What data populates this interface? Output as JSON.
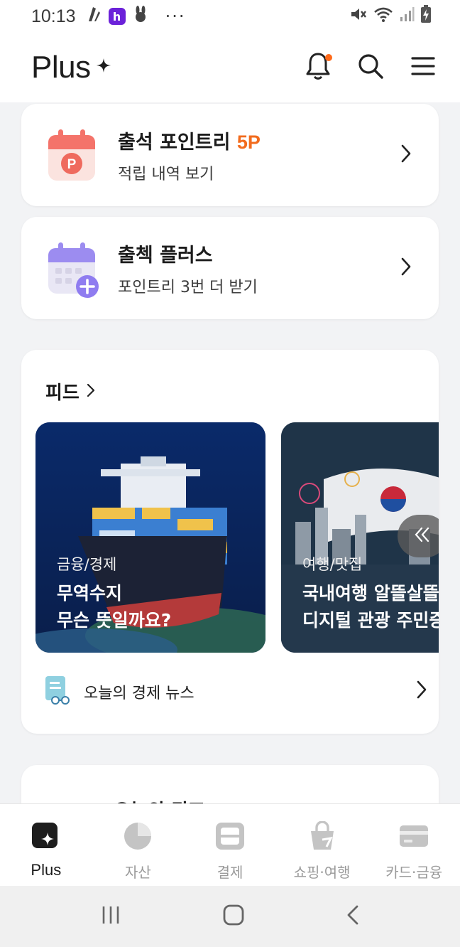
{
  "status": {
    "time": "10:13",
    "icons": [
      "gesture-icon",
      "h-app-icon",
      "bunny-icon",
      "more-notif-icon"
    ],
    "right_icons": [
      "mute-icon",
      "wifi-icon",
      "signal-icon",
      "battery-charging-icon"
    ],
    "more": "···"
  },
  "header": {
    "brand": "Plus",
    "icons": [
      "bell-icon",
      "search-icon",
      "menu-icon"
    ],
    "colors": {
      "notification_dot": "#ff6a1a"
    }
  },
  "attendance": {
    "title": "출석 포인트리 ",
    "points": "5P",
    "subtitle": "적립 내역 보기",
    "icon": "calendar-p-icon"
  },
  "check_plus": {
    "title": "출첵 플러스",
    "subtitle": "포인트리 3번 더 받기",
    "icon": "calendar-plus-icon"
  },
  "feed": {
    "title": "피드",
    "tiles": [
      {
        "category": "금융/경제",
        "headline": "무역수지\n무슨 뜻일까요?",
        "image": "cargo-ship-illustration"
      },
      {
        "category": "여행/맛집",
        "headline": "국내여행 알뜰살뜰\n디지털 관광 주민증",
        "image": "korea-skyline-illustration"
      }
    ],
    "news_label": "오늘의 경제 뉴스"
  },
  "next_card_partial": "오늘의 퀴즈",
  "nav": {
    "tabs": [
      {
        "label": "Plus",
        "icon": "plus-sparkle-icon",
        "active": true
      },
      {
        "label": "자산",
        "icon": "pie-chart-icon",
        "active": false
      },
      {
        "label": "결제",
        "icon": "scan-pay-icon",
        "active": false
      },
      {
        "label": "쇼핑·여행",
        "icon": "shopping-travel-icon",
        "active": false
      },
      {
        "label": "카드·금융",
        "icon": "card-icon",
        "active": false
      }
    ]
  },
  "sysnav": {
    "icons": [
      "recents-icon",
      "home-icon",
      "back-icon"
    ]
  },
  "colors": {
    "accent_orange": "#f26b1d",
    "calendar_red": "#f4736a",
    "calendar_purple": "#8f7cf0",
    "inactive": "#b9b9b9"
  }
}
